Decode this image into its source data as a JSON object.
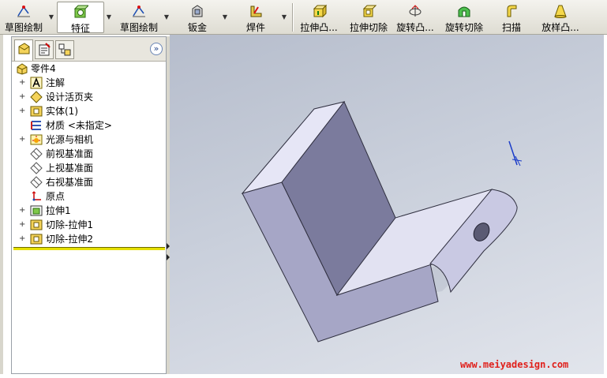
{
  "toolbar": {
    "buttons": [
      {
        "label": "草图绘制",
        "icon": "sketch-icon"
      },
      {
        "label": "特征",
        "icon": "features-icon"
      },
      {
        "label": "草图绘制",
        "icon": "sketch-icon"
      },
      {
        "label": "钣金",
        "icon": "sheet-metal-icon"
      },
      {
        "label": "焊件",
        "icon": "weldment-icon"
      },
      {
        "label": "拉伸凸...",
        "icon": "extrude-boss-icon"
      },
      {
        "label": "拉伸切除",
        "icon": "extrude-cut-icon"
      },
      {
        "label": "旋转凸...",
        "icon": "revolve-boss-icon"
      },
      {
        "label": "旋转切除",
        "icon": "revolve-cut-icon"
      },
      {
        "label": "扫描",
        "icon": "sweep-icon"
      },
      {
        "label": "放样凸...",
        "icon": "loft-boss-icon"
      }
    ]
  },
  "panel": {
    "tabs": [
      "featuremanager-tab",
      "propertymanager-tab",
      "configurationmanager-tab"
    ],
    "expand_glyph": "»",
    "tree": [
      {
        "label": "零件4",
        "icon": "part-icon",
        "expandable": false
      },
      {
        "label": "注解",
        "icon": "annotations-icon",
        "expandable": true
      },
      {
        "label": "设计活页夹",
        "icon": "design-binder-icon",
        "expandable": true
      },
      {
        "label": "实体(1)",
        "icon": "solid-bodies-icon",
        "expandable": true
      },
      {
        "label": "材质 <未指定>",
        "icon": "material-icon",
        "expandable": false
      },
      {
        "label": "光源与相机",
        "icon": "lights-cameras-icon",
        "expandable": true
      },
      {
        "label": "前视基准面",
        "icon": "plane-icon",
        "expandable": false
      },
      {
        "label": "上视基准面",
        "icon": "plane-icon",
        "expandable": false
      },
      {
        "label": "右视基准面",
        "icon": "plane-icon",
        "expandable": false
      },
      {
        "label": "原点",
        "icon": "origin-icon",
        "expandable": false
      },
      {
        "label": "拉伸1",
        "icon": "extrude-feature-icon",
        "expandable": true
      },
      {
        "label": "切除-拉伸1",
        "icon": "cut-feature-icon",
        "expandable": true
      },
      {
        "label": "切除-拉伸2",
        "icon": "cut-feature-icon",
        "expandable": true
      }
    ]
  },
  "watermark": "www.meiyadesign.com",
  "colors": {
    "model_face_light": "#e4e4f4",
    "model_face_mid": "#a9a9c9",
    "model_face_dark": "#7b7b9a",
    "viewport_bg": "#c9cfdb",
    "rollback_bar": "#e6e000",
    "watermark": "#e0201b"
  }
}
